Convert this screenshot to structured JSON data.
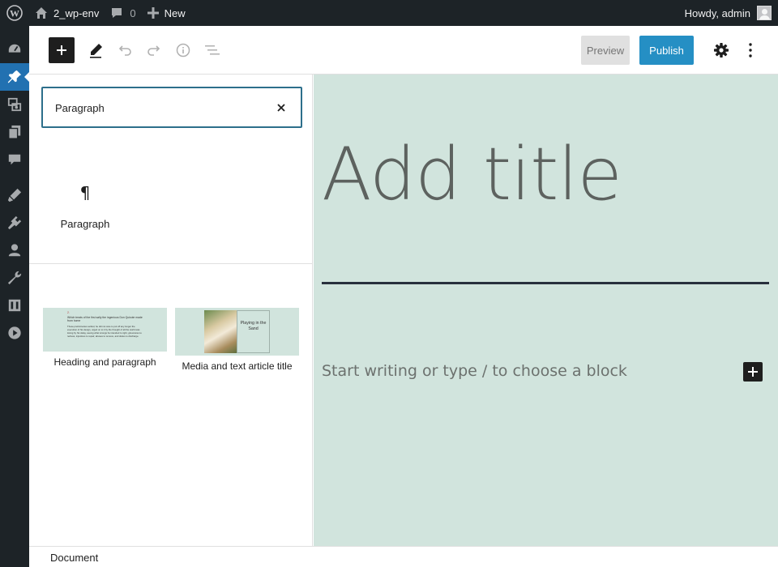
{
  "admin_bar": {
    "logo_icon": "wordpress-logo-icon",
    "site_name": "2_wp-env",
    "comments_count": "0",
    "new_label": "New",
    "greeting": "Howdy, admin"
  },
  "admin_menu": {
    "items": [
      {
        "icon": "dashboard-icon"
      },
      {
        "icon": "pin-icon",
        "active": true
      },
      {
        "icon": "media-icon"
      },
      {
        "icon": "pages-icon"
      },
      {
        "icon": "comments-icon"
      },
      {
        "icon": "appearance-icon"
      },
      {
        "icon": "plugins-icon"
      },
      {
        "icon": "users-icon"
      },
      {
        "icon": "tools-icon"
      },
      {
        "icon": "settings-icon"
      },
      {
        "icon": "play-icon"
      }
    ]
  },
  "toolbar": {
    "preview_label": "Preview",
    "publish_label": "Publish"
  },
  "inserter": {
    "search": {
      "value": "Paragraph"
    },
    "block": {
      "icon": "¶",
      "label": "Paragraph"
    },
    "patterns": [
      {
        "label": "Heading and paragraph",
        "preview_number": "2.",
        "preview_heading": "Which treats of the first sally the ingenious Don Quixote made from home",
        "preview_body": "These preliminaries settled, he did not care to put off any longer the execution of his design, urged on to it by the thought of all the world was losing by his delay, seeing what wrongs he intended to right, grievances to redress, injustices to repair, abuses to remove, and duties to discharge."
      },
      {
        "label": "Media and text article title",
        "preview_title": "Playing in the Sand"
      }
    ]
  },
  "canvas": {
    "title_placeholder": "Add title",
    "block_placeholder": "Start writing or type / to choose a block",
    "background": "#d1e4dd"
  },
  "footer": {
    "breadcrumb": "Document"
  },
  "colors": {
    "admin_dark": "#1d2327",
    "accent": "#007cba",
    "menu_active": "#2271b1"
  }
}
